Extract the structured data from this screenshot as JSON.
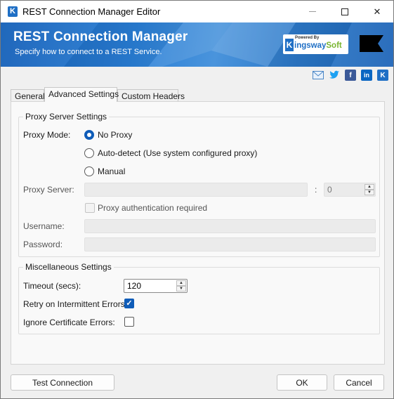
{
  "window": {
    "title": "REST Connection Manager Editor",
    "app_icon_letter": "K"
  },
  "banner": {
    "title": "REST Connection Manager",
    "subtitle": "Specify how to connect to a REST Service.",
    "logo_powered_by": "Powered By",
    "logo_k": "K",
    "logo_word_main": "ingsway",
    "logo_word_soft": "Soft"
  },
  "social": {
    "icons": [
      "email-icon",
      "twitter-icon",
      "facebook-icon",
      "linkedin-icon",
      "kingswaysoft-icon"
    ],
    "facebook_glyph": "f",
    "linkedin_glyph": "in",
    "kingsway_glyph": "K"
  },
  "tabs": [
    {
      "label": "General",
      "active": false
    },
    {
      "label": "Advanced Settings",
      "active": true
    },
    {
      "label": "Custom Headers",
      "active": false
    }
  ],
  "proxy": {
    "group_title": "Proxy Server Settings",
    "mode_label": "Proxy Mode:",
    "options": [
      {
        "label": "No Proxy",
        "checked": true
      },
      {
        "label": "Auto-detect (Use system configured proxy)",
        "checked": false
      },
      {
        "label": "Manual",
        "checked": false
      }
    ],
    "server_label": "Proxy Server:",
    "server_value": "",
    "port_separator": ":",
    "port_value": "0",
    "auth_label": "Proxy authentication required",
    "auth_checked": false,
    "username_label": "Username:",
    "username_value": "",
    "password_label": "Password:",
    "password_value": ""
  },
  "misc": {
    "group_title": "Miscellaneous Settings",
    "timeout_label": "Timeout (secs):",
    "timeout_value": "120",
    "retry_label": "Retry on Intermittent Errors:",
    "retry_checked": true,
    "ignore_cert_label": "Ignore Certificate Errors:",
    "ignore_cert_checked": false
  },
  "buttons": {
    "test_connection": "Test Connection",
    "ok": "OK",
    "cancel": "Cancel"
  },
  "glyphs": {
    "check": "✓",
    "spin_up": "▲",
    "spin_down": "▼",
    "close": "✕"
  },
  "colors": {
    "accent": "#0f5cb8",
    "banner_blue": "#1f6fc5",
    "logo_green": "#79b530"
  }
}
